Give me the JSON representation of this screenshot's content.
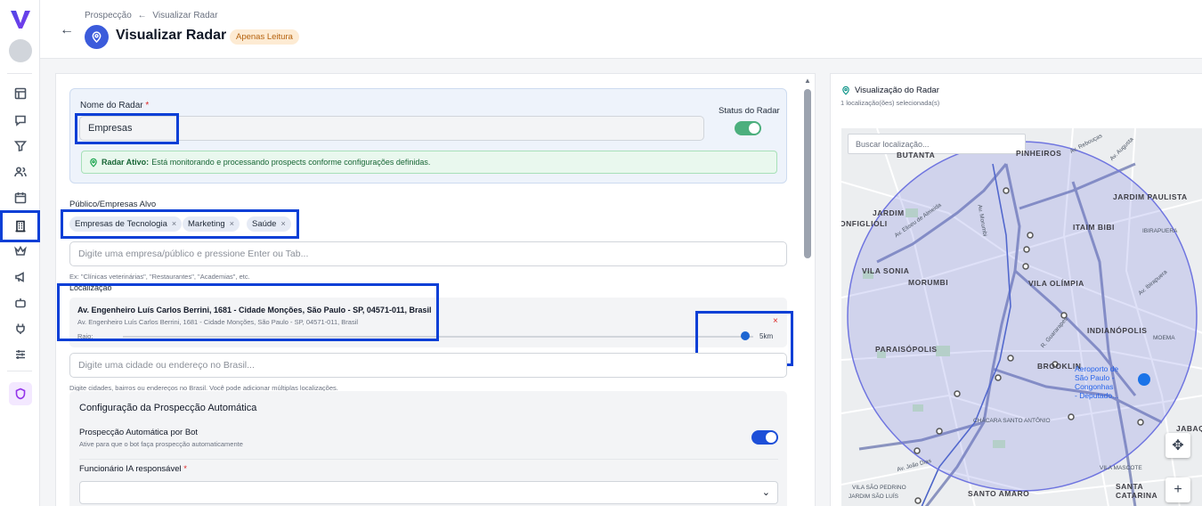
{
  "app": {
    "logo_letter": "V"
  },
  "sidebar": {
    "icons": [
      "layout-icon",
      "chat-icon",
      "filter-icon",
      "users-icon",
      "calendar-icon",
      "building-icon",
      "crown-icon",
      "megaphone-icon",
      "bot-icon",
      "plug-icon",
      "sliders-icon",
      "shield-icon"
    ],
    "active": "building-icon"
  },
  "header": {
    "breadcrumb_parent": "Prospecção",
    "breadcrumb_arrow": "←",
    "breadcrumb_current": "Visualizar Radar",
    "title": "Visualizar Radar",
    "badge": "Apenas Leitura"
  },
  "form": {
    "name_label": "Nome do Radar",
    "required_mark": "*",
    "name_value": "Empresas",
    "status_label": "Status do Radar",
    "status_on": true,
    "alert_bold": "Radar Ativo:",
    "alert_text": "Está monitorando e processando prospects conforme configurações definidas.",
    "audience_label": "Público/Empresas Alvo",
    "chips": [
      "Empresas de Tecnologia",
      "Marketing",
      "Saúde"
    ],
    "chip_remove": "×",
    "audience_placeholder": "Digite uma empresa/público e pressione Enter ou Tab...",
    "audience_hint": "Ex: \"Clínicas veterinárias\", \"Restaurantes\", \"Academias\", etc.",
    "location_label": "Localização",
    "location_main": "Av. Engenheiro Luís Carlos Berrini, 1681 - Cidade Monções, São Paulo - SP, 04571-011, Brasil",
    "location_sub": "Av. Engenheiro Luís Carlos Berrini, 1681 - Cidade Monções, São Paulo - SP, 04571-011, Brasil",
    "radius_label": "Raio:",
    "radius_value": "5km",
    "radius_fraction": 0.98,
    "remove_location": "×",
    "address_placeholder": "Digite uma cidade ou endereço no Brasil...",
    "address_hint": "Digite cidades, bairros ou endereços no Brasil. Você pode adicionar múltiplas localizações."
  },
  "automation": {
    "title": "Configuração da Prospecção Automática",
    "bot_label": "Prospecção Automática por Bot",
    "bot_sub": "Ative para que o bot faça prospecção automaticamente",
    "bot_on": true,
    "employee_label": "Funcionário IA responsável",
    "employee_value": ""
  },
  "map": {
    "title": "Visualização do Radar",
    "subtitle": "1 localização(ões) selecionada(s)",
    "search_placeholder": "Buscar localização...",
    "zoom_in": "+",
    "places": [
      "PINHEIROS",
      "JARDIM PAULISTA",
      "ITAIM BIBI",
      "VILA SONIA",
      "MORUMBI",
      "VILA OLÍMPIA",
      "INDIANÓPOLIS",
      "PARAISÓPOLIS",
      "BROOKLIN",
      "SANTO AMARO",
      "JARDIM",
      "ONFIGLIOLI",
      "JABAQ",
      "SANTA",
      "CATARINA",
      "BUTANTA"
    ],
    "streets": [
      "Av. Rebouças",
      "Av. Augusta",
      "Av. Eliseu de Almeida",
      "R. Guararapes",
      "Av. Ibirapuera",
      "Av. João Dias",
      "CHÁCARA SANTO ANTÔNIO",
      "VILA SÃO PEDRINO",
      "JARDIM SÃO LUÍS",
      "Av. Morumbi",
      "IBIRAPUERA",
      "MOEMA",
      "VILA MASCOTE"
    ],
    "airport": [
      "Aeroporto de",
      "São Paulo -",
      "Congonhas",
      "- Deputado..."
    ],
    "accent": "#6f75e0"
  },
  "colors": {
    "primary": "#3b5bdb",
    "highlight": "#0a3fd6",
    "toggle": "#1d4fd8",
    "toggle_success": "#4caf7d"
  }
}
